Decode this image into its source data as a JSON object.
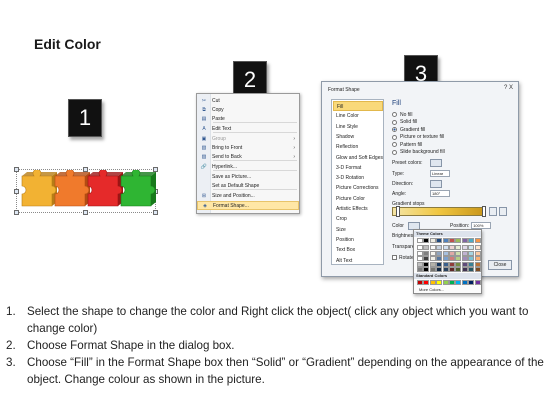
{
  "title": "Edit Color",
  "steps": [
    "1",
    "2",
    "3"
  ],
  "puzzle": {
    "pieces": [
      {
        "color": "#f2b233",
        "shade": "#b77d17"
      },
      {
        "color": "#f07a2c",
        "shade": "#b34c13"
      },
      {
        "color": "#e52a2a",
        "shade": "#9c1515"
      },
      {
        "color": "#2fb533",
        "shade": "#177a1b"
      }
    ]
  },
  "context_menu": {
    "items": [
      {
        "label": "Cut",
        "icon": "cut-icon",
        "glyph": "✂",
        "dim": false
      },
      {
        "label": "Copy",
        "icon": "copy-icon",
        "glyph": "⧉",
        "dim": false
      },
      {
        "label": "Paste",
        "icon": "paste-icon",
        "glyph": "▤",
        "dim": false
      },
      {
        "label": "Edit Text",
        "icon": "edit-text-icon",
        "glyph": "A",
        "dim": false
      },
      {
        "label": "Group",
        "icon": "group-icon",
        "glyph": "▣",
        "dim": true,
        "submenu": true
      },
      {
        "label": "Bring to Front",
        "icon": "bring-to-front-icon",
        "glyph": "▧",
        "dim": false,
        "submenu": true
      },
      {
        "label": "Send to Back",
        "icon": "send-to-back-icon",
        "glyph": "▨",
        "dim": false,
        "submenu": true
      },
      {
        "label": "Hyperlink...",
        "icon": "hyperlink-icon",
        "glyph": "🔗",
        "dim": false
      },
      {
        "label": "Save as Picture...",
        "icon": "",
        "glyph": "",
        "dim": false
      },
      {
        "label": "Set as Default Shape",
        "icon": "",
        "glyph": "",
        "dim": false
      },
      {
        "label": "Size and Position...",
        "icon": "size-position-icon",
        "glyph": "⊞",
        "dim": false
      },
      {
        "label": "Format Shape...",
        "icon": "format-shape-icon",
        "glyph": "◈",
        "dim": false,
        "highlight": true
      }
    ]
  },
  "dialog": {
    "title": "Format Shape",
    "help": "? X",
    "nav": [
      "Fill",
      "Line Color",
      "Line Style",
      "Shadow",
      "Reflection",
      "Glow and Soft Edges",
      "3-D Format",
      "3-D Rotation",
      "Picture Corrections",
      "Picture Color",
      "Artistic Effects",
      "Crop",
      "Size",
      "Position",
      "Text Box",
      "Alt Text"
    ],
    "fill_heading": "Fill",
    "fill_options": [
      "No fill",
      "Solid fill",
      "Gradient fill",
      "Picture or texture fill",
      "Pattern fill",
      "Slide background fill"
    ],
    "fields": [
      "Preset colors:",
      "Type:",
      "Direction:",
      "Angle:"
    ],
    "type_value": "Linear",
    "angle_value": "180°",
    "gradient_stops_label": "Gradient stops",
    "color_label": "Color",
    "brightness_label": "Brightness:",
    "transparency_label": "Transparency:",
    "position_label": "Position:",
    "position_value": "100%",
    "rotate_label": "Rotate",
    "close_label": "Close"
  },
  "color_picker": {
    "theme_label": "Theme Colors",
    "standard_label": "Standard Colors",
    "more_label": "More Colors...",
    "theme_top": [
      "#ffffff",
      "#000000",
      "#eeece1",
      "#1f497d",
      "#4f81bd",
      "#c0504d",
      "#9bbb59",
      "#8064a2",
      "#4bacc6",
      "#f79646"
    ],
    "standard": [
      "#c00000",
      "#ff0000",
      "#ffc000",
      "#ffff00",
      "#92d050",
      "#00b050",
      "#00b0f0",
      "#0070c0",
      "#002060",
      "#7030a0"
    ]
  },
  "instructions": [
    {
      "num": "1.",
      "text": "Select the shape to change the color and Right click the object( click any object which you want to change color)"
    },
    {
      "num": "2.",
      "text": "Choose Format Shape in the dialog box."
    },
    {
      "num": "3.",
      "text": "Choose “Fill” in the Format Shape box then “Solid” or “Gradient” depending on the appearance of the object. Change colour as shown in the picture."
    }
  ]
}
